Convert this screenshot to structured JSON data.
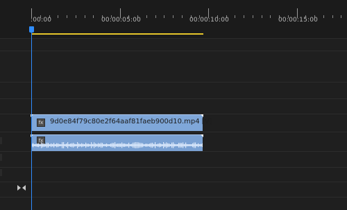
{
  "ruler": {
    "labels": [
      ":00:00",
      "00:00:05:00",
      "00:00:10:00",
      "00:00:15:00"
    ]
  },
  "tracks": {
    "video_clip": {
      "name": "9d0e84f79c80e2f64aaf81faeb900d10.mp4 [V]",
      "fx_badge": "fx"
    },
    "audio_clip": {
      "fx_badge": "fx"
    }
  },
  "icons": {
    "playhead": "playhead-handle-icon",
    "snap": "snap-icon"
  },
  "colors": {
    "accent": "#2f8dff",
    "work_area": "#e6c52b",
    "clip": "#7fa7d9"
  }
}
